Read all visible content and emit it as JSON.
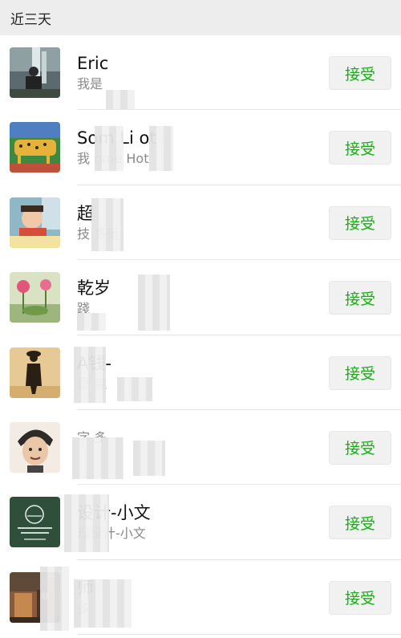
{
  "header": {
    "title": "近三天"
  },
  "requests": [
    {
      "name": "Eric",
      "message": "我是",
      "accept_label": "接受",
      "avatar": "waterfall-portrait"
    },
    {
      "name": "Som Li ot",
      "message": "我 ome Hot",
      "accept_label": "接受",
      "avatar": "leopard-painting"
    },
    {
      "name": "超",
      "message": "技 多运",
      "accept_label": "接受",
      "avatar": "child-photo"
    },
    {
      "name": "乾岁",
      "message": "踐",
      "accept_label": "接受",
      "avatar": "pink-flowers"
    },
    {
      "name": "A钱-",
      "message": "是 竟",
      "accept_label": "接受",
      "avatar": "silhouette-figure"
    },
    {
      "name": "",
      "message": "字 多",
      "accept_label": "接受",
      "avatar": "caricature"
    },
    {
      "name": "设计-小文",
      "message": "现设计-小文",
      "accept_label": "接受",
      "avatar": "green-logo"
    },
    {
      "name": "师",
      "message": "多",
      "accept_label": "接受",
      "avatar": "room-photo"
    }
  ]
}
